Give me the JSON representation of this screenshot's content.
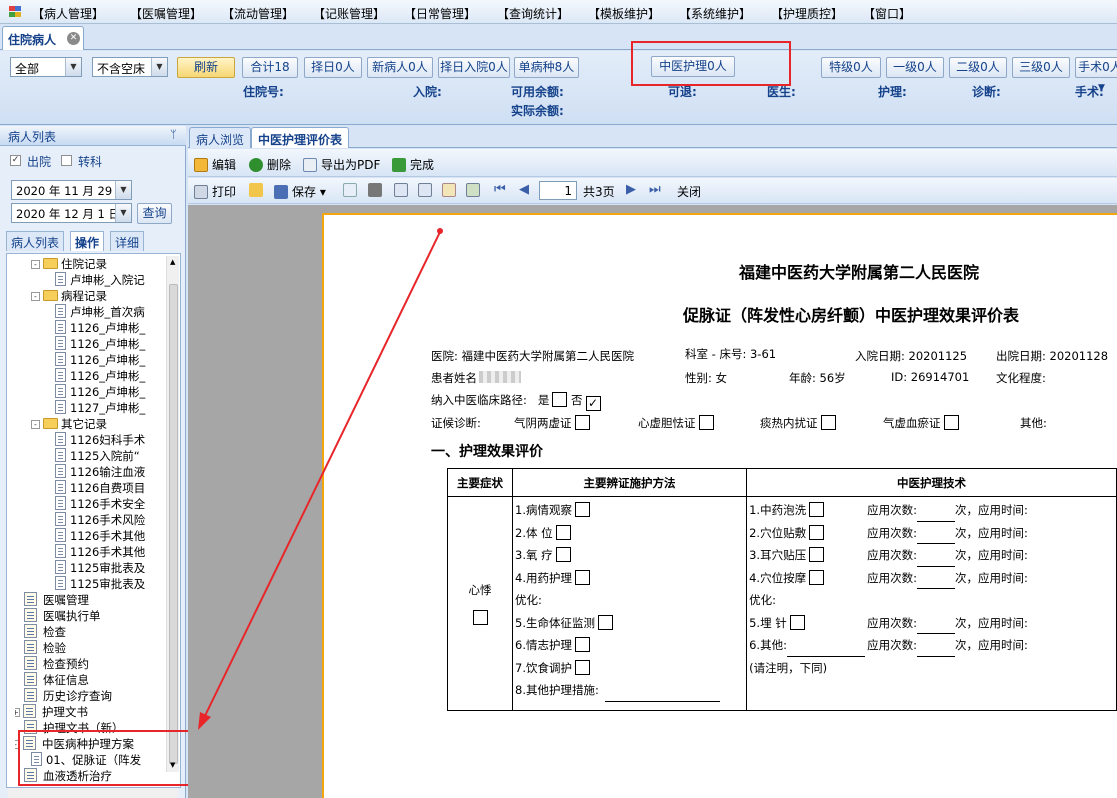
{
  "menu": [
    "【病人管理】",
    "【医嘱管理】",
    "【流动管理】",
    "【记账管理】",
    "【日常管理】",
    "【查询统计】",
    "【模板维护】",
    "【系统维护】",
    "【护理质控】",
    "【窗口】"
  ],
  "main_tab": {
    "label": "住院病人"
  },
  "filters": {
    "ward": "全部",
    "bed": "不含空床"
  },
  "buttons": {
    "refresh": "刷新",
    "total": "合计18",
    "select_out": "择日0人",
    "new_patient": "新病人0人",
    "select_admit": "择日入院0人",
    "single_disease": "单病种8人",
    "tcm_nursing": "中医护理0人",
    "special": "特级0人",
    "level1": "一级0人",
    "level2": "二级0人",
    "level3": "三级0人",
    "surgery": "手术0人"
  },
  "info_labels": {
    "admission_no": "住院号:",
    "admit": "入院:",
    "available_balance": "可用余额:",
    "actual_balance": "实际余额:",
    "returnable": "可退:",
    "doctor": "医生:",
    "nursing": "护理:",
    "diagnosis": "诊断:",
    "surgery": "手术:"
  },
  "left_panel": {
    "title": "病人列表",
    "discharge_label": "出院",
    "transfer_label": "转科",
    "date_from": "2020 年 11 月 29",
    "date_to": "2020 年 12 月 1 日",
    "query_btn": "查询",
    "tabs": [
      "病人列表",
      "操作",
      "详细"
    ],
    "tree": [
      {
        "kind": "folder",
        "label": "住院记录",
        "indent": 1
      },
      {
        "kind": "doc",
        "label": "卢坤彬_入院记",
        "indent": 2
      },
      {
        "kind": "folder",
        "label": "病程记录",
        "indent": 1
      },
      {
        "kind": "doc",
        "label": "卢坤彬_首次病",
        "indent": 2
      },
      {
        "kind": "doc",
        "label": "1126_卢坤彬_",
        "indent": 2
      },
      {
        "kind": "doc",
        "label": "1126_卢坤彬_",
        "indent": 2
      },
      {
        "kind": "doc",
        "label": "1126_卢坤彬_",
        "indent": 2
      },
      {
        "kind": "doc",
        "label": "1126_卢坤彬_",
        "indent": 2
      },
      {
        "kind": "doc",
        "label": "1126_卢坤彬_",
        "indent": 2
      },
      {
        "kind": "doc",
        "label": "1127_卢坤彬_",
        "indent": 2
      },
      {
        "kind": "folder",
        "label": "其它记录",
        "indent": 1
      },
      {
        "kind": "doc",
        "label": "1126妇科手术",
        "indent": 2
      },
      {
        "kind": "doc",
        "label": "1125入院前“",
        "indent": 2
      },
      {
        "kind": "doc",
        "label": "1126输注血液",
        "indent": 2
      },
      {
        "kind": "doc",
        "label": "1126自费项目",
        "indent": 2
      },
      {
        "kind": "doc",
        "label": "1126手术安全",
        "indent": 2
      },
      {
        "kind": "doc",
        "label": "1126手术风险",
        "indent": 2
      },
      {
        "kind": "doc",
        "label": "1126手术其他",
        "indent": 2
      },
      {
        "kind": "doc",
        "label": "1126手术其他",
        "indent": 2
      },
      {
        "kind": "doc",
        "label": "1125审批表及",
        "indent": 2
      },
      {
        "kind": "doc",
        "label": "1125审批表及",
        "indent": 2
      },
      {
        "kind": "node",
        "label": "医嘱管理",
        "indent": 0
      },
      {
        "kind": "node",
        "label": "医嘱执行单",
        "indent": 0
      },
      {
        "kind": "node",
        "label": "检查",
        "indent": 0
      },
      {
        "kind": "node",
        "label": "检验",
        "indent": 0
      },
      {
        "kind": "node",
        "label": "检查预约",
        "indent": 0
      },
      {
        "kind": "node",
        "label": "体征信息",
        "indent": 0
      },
      {
        "kind": "node",
        "label": "历史诊疗查询",
        "indent": 0
      },
      {
        "kind": "node",
        "label": "护理文书",
        "indent": 0,
        "expander": "+"
      },
      {
        "kind": "node",
        "label": "护理文书（新）",
        "indent": 0
      },
      {
        "kind": "node",
        "label": "中医病种护理方案",
        "indent": 0,
        "expander": "-"
      },
      {
        "kind": "doc",
        "label": "01、促脉证（阵发",
        "indent": 1
      },
      {
        "kind": "node",
        "label": "血液透析治疗",
        "indent": 0
      }
    ]
  },
  "doc_tabs": [
    "病人浏览",
    "中医护理评价表"
  ],
  "toolbar1": {
    "edit": "编辑",
    "delete": "删除",
    "export_pdf": "导出为PDF",
    "done": "完成"
  },
  "toolbar2": {
    "print": "打印",
    "save": "保存",
    "page": "1",
    "page_total": "共3页",
    "close": "关闭"
  },
  "document": {
    "hospital": "福建中医药大学附属第二人民医院",
    "title": "促脉证（阵发性心房纤颤）中医护理效果评价表",
    "hospital_label": "医院: 福建中医药大学附属第二人民医院",
    "dept_bed": "科室 - 床号:  3-61",
    "admit_date": "入院日期: 20201125",
    "discharge_date": "出院日期: 20201128",
    "patient_name": "患者姓名",
    "sex": "性别: 女",
    "age": "年龄: 56岁",
    "id": "ID: 26914701",
    "education": "文化程度:",
    "pathway": "纳入中医临床路径:",
    "yes": "是",
    "no": "否",
    "diag_label": "证候诊断:",
    "diag_opts": [
      "气阴两虚证",
      "心虚胆怯证",
      "痰热内扰证",
      "气虚血瘀证"
    ],
    "diag_other": "其他:",
    "section1": "一、护理效果评价",
    "col_headers": [
      "主要症状",
      "主要辨证施护方法",
      "中医护理技术"
    ],
    "symptom": "心悸",
    "methods": [
      "1.病情观察",
      "2.体    位",
      "3.氧    疗",
      "4.用药护理",
      "优化:",
      "5.生命体征监测",
      "6.情志护理",
      "7.饮食调护",
      "8.其他护理措施:"
    ],
    "techniques": [
      "1.中药泡洗",
      "2.穴位贴敷",
      "3.耳穴贴压",
      "4.穴位按摩",
      "优化:",
      "5.埋    针",
      "6.其他:",
      "(请注明，下同)"
    ],
    "use_count": "应用次数:",
    "use_time": "次，应用时间:"
  }
}
